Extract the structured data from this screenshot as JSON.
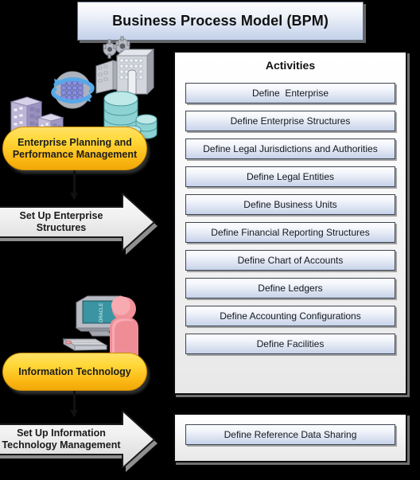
{
  "title": {
    "text": "Business Process Model (BPM)"
  },
  "activities_panel": {
    "heading": "Activities",
    "items": [
      "Define  Enterprise",
      "Define Enterprise Structures",
      "Define Legal Jurisdictions and Authorities",
      "Define Legal Entities",
      "Define Business Units",
      "Define Financial Reporting Structures",
      "Define Chart of Accounts",
      "Define Ledgers",
      "Define Accounting Configurations",
      "Define Facilities"
    ]
  },
  "bottom_panel": {
    "items": [
      "Define Reference Data Sharing"
    ]
  },
  "groups": [
    {
      "pill_label": "Enterprise Planning and Performance Management",
      "arrow_label": "Set Up Enterprise Structures",
      "icons": [
        "factory-gears-icon",
        "globe-network-icon",
        "office-buildings-icon",
        "database-stack-icon"
      ]
    },
    {
      "pill_label": "Information Technology",
      "arrow_label": "Set Up Information Technology Management",
      "icons": [
        "computer-monitor-icon",
        "person-icon"
      ]
    }
  ],
  "colors": {
    "background": "#000000",
    "pill_top": "#ffe066",
    "pill_bottom": "#f0a808",
    "activity_top": "#fdfdfe",
    "activity_bottom": "#c6d2e8",
    "panel_border": "#0b0b0b",
    "arrow_fill": "#e8e8e8"
  }
}
